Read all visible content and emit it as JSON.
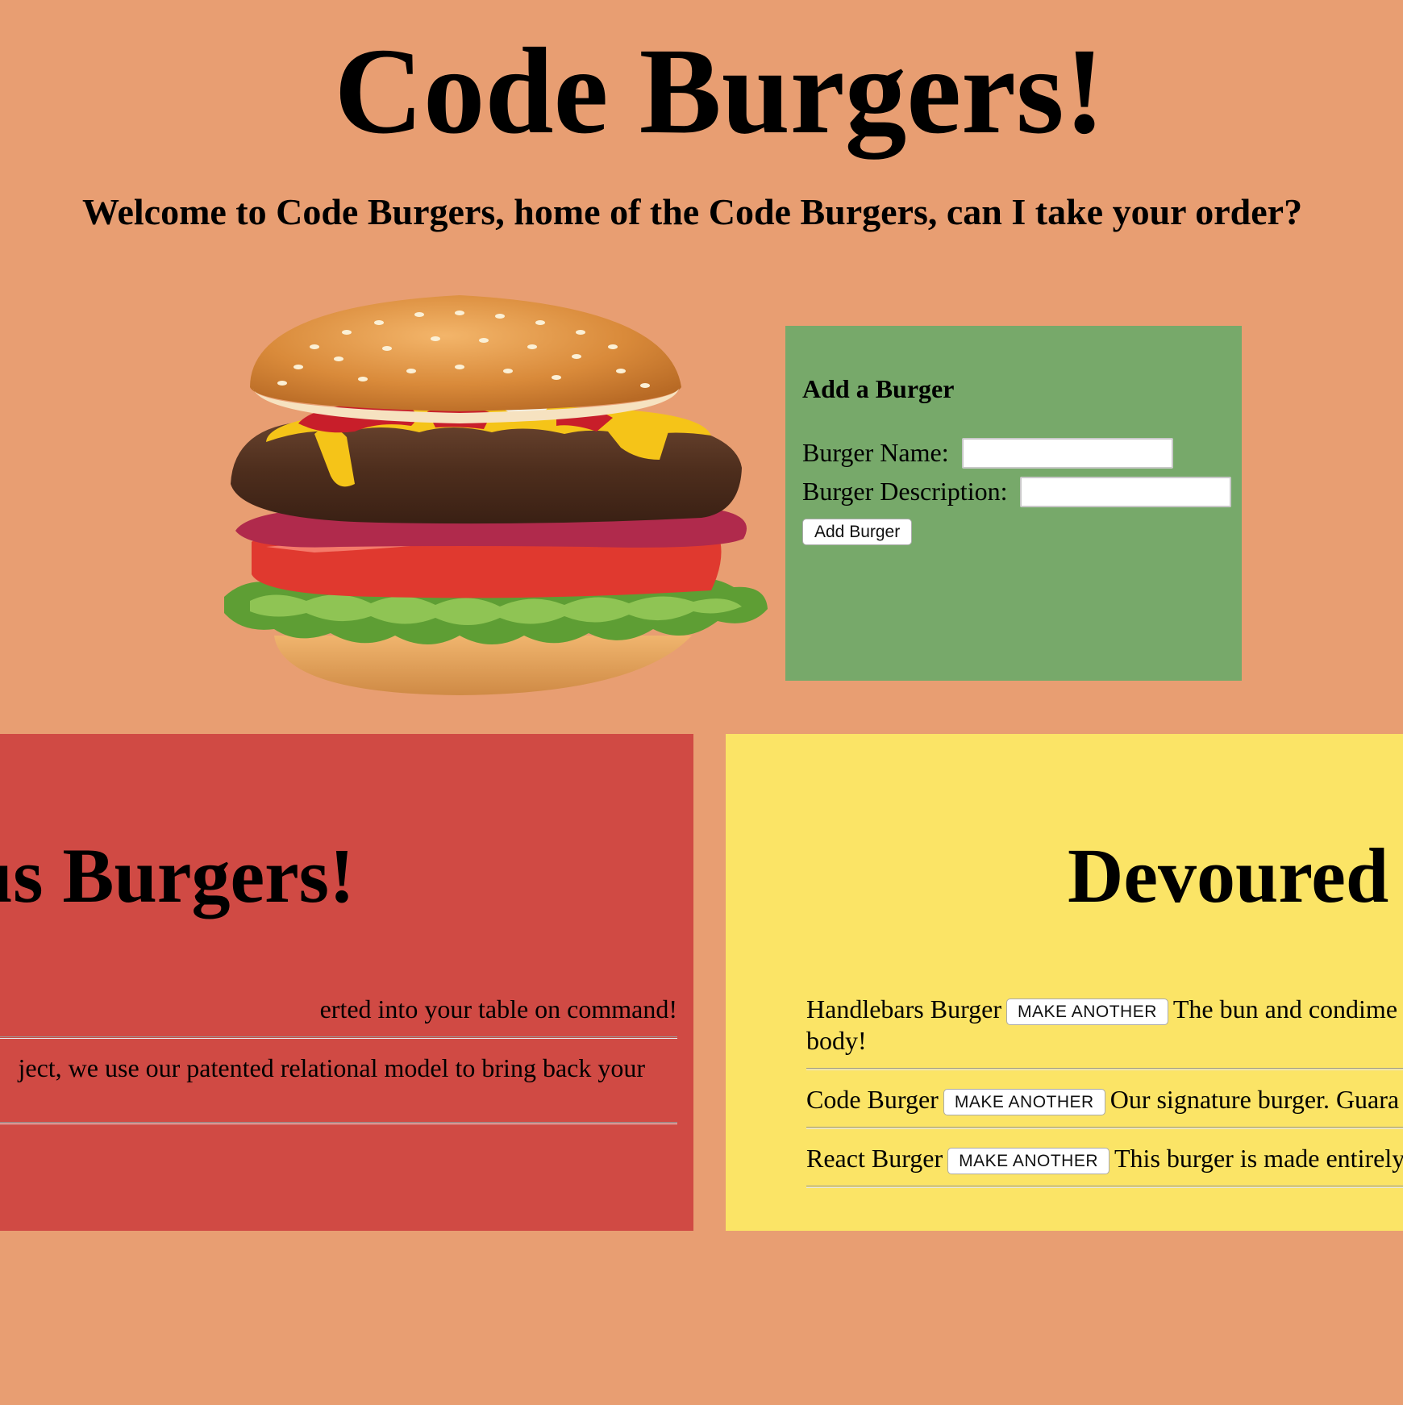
{
  "header": {
    "title": "Code Burgers!",
    "welcome": "Welcome to Code Burgers, home of the Code Burgers, can I take your order?"
  },
  "add_form": {
    "title": "Add a Burger",
    "name_label": "Burger Name:",
    "name_value": "",
    "description_label": "Burger Description:",
    "description_value": "",
    "submit_label": "Add Burger"
  },
  "uneaten": {
    "heading": "us Burgers!",
    "items": [
      {
        "text": "erted into your table on command!"
      },
      {
        "text": "ject, we use our patented relational model to bring back your"
      }
    ]
  },
  "devoured": {
    "heading": "Devoured",
    "button_label": "MAKE ANOTHER",
    "items": [
      {
        "name": "Handlebars Burger",
        "description": "The bun and condime",
        "description_cont": "body!"
      },
      {
        "name": "Code Burger",
        "description": "Our signature burger. Guara"
      },
      {
        "name": "React Burger",
        "description": "This burger is made entirely"
      }
    ]
  },
  "colors": {
    "background": "#e89e72",
    "add_panel": "#77a96a",
    "uneaten_panel": "#d04a44",
    "devoured_panel": "#fbe466"
  }
}
